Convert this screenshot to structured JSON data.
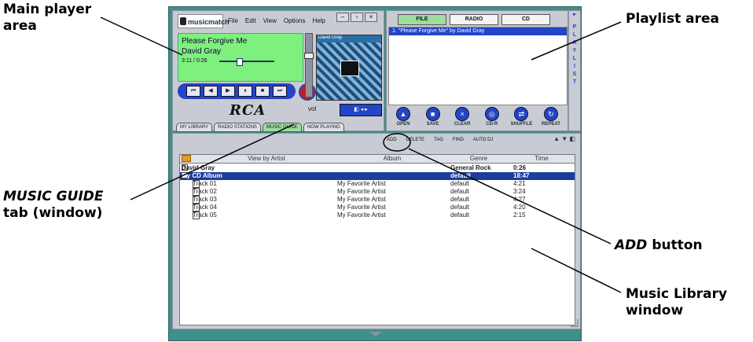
{
  "callouts": {
    "main_player": "Main player area",
    "playlist": "Playlist area",
    "music_guide_tab": "MUSIC GUIDE",
    "music_guide_suffix": "tab (window)",
    "add_button": "ADD",
    "add_button_suffix": "button",
    "music_library": "Music Library window"
  },
  "app": {
    "logo": "musicmatch",
    "menu": [
      "File",
      "Edit",
      "View",
      "Options",
      "Help"
    ],
    "now_playing": {
      "song": "Please Forgive Me",
      "artist": "David Gray",
      "time": "3:11 / 0:26"
    },
    "album_art_title": "David Gray",
    "vol_label": "vol",
    "brand": "RCA",
    "transport": [
      "⏮",
      "◀",
      "▶",
      "⏸",
      "■",
      "⏭"
    ],
    "info_label": "i",
    "player_tabs": [
      "MY LIBRARY",
      "RADIO STATIONS",
      "MUSIC GUIDE",
      "NOW PLAYING"
    ],
    "playlist_tabs": [
      "FILE",
      "RADIO",
      "CD"
    ],
    "playlist_item": "1. \"Please Forgive Me\" by David Gray",
    "playlist_buttons": [
      "OPEN",
      "SAVE",
      "CLEAR",
      "CD-R",
      "SHUFFLE",
      "REPEAT"
    ],
    "side_strip": [
      "P",
      "L",
      "A",
      "Y",
      "L",
      "I",
      "S",
      "T"
    ],
    "library_toolbar": [
      "ADD",
      "DELETE",
      "TAG",
      "FIND",
      "AUTO DJ"
    ],
    "library_headers": [
      "View by Artist",
      "Album",
      "Genre",
      "Time"
    ],
    "library_rows": [
      {
        "name": "David Gray",
        "album": "",
        "genre": "General Rock",
        "time": "0:26",
        "kind": "artist"
      },
      {
        "name": "My CD Album",
        "album": "",
        "genre": "default",
        "time": "18:47",
        "kind": "album"
      },
      {
        "name": "Track 01",
        "album": "My Favorite Artist",
        "genre": "default",
        "time": "4:21",
        "kind": "track"
      },
      {
        "name": "Track 02",
        "album": "My Favorite Artist",
        "genre": "default",
        "time": "3:24",
        "kind": "track"
      },
      {
        "name": "Track 03",
        "album": "My Favorite Artist",
        "genre": "default",
        "time": "4:27",
        "kind": "track"
      },
      {
        "name": "Track 04",
        "album": "My Favorite Artist",
        "genre": "default",
        "time": "4:20",
        "kind": "track"
      },
      {
        "name": "Track 05",
        "album": "My Favorite Artist",
        "genre": "default",
        "time": "2:15",
        "kind": "track"
      }
    ]
  }
}
